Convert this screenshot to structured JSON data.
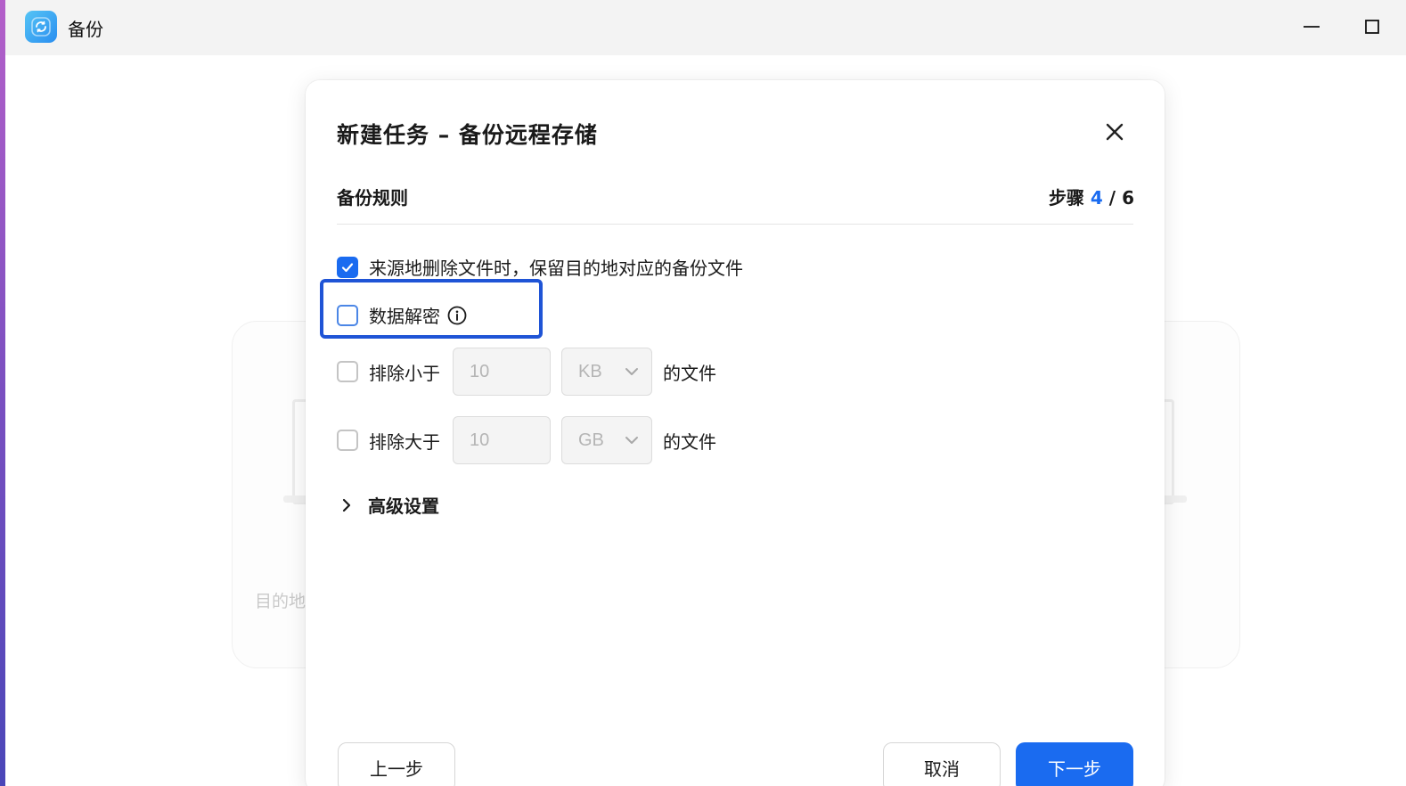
{
  "app": {
    "title": "备份"
  },
  "background": {
    "label": "目的地"
  },
  "dialog": {
    "title": "新建任务 – 备份远程存储",
    "section_title": "备份规则",
    "step_prefix": "步骤",
    "step_current": "4",
    "step_separator": "/",
    "step_total": "6",
    "options": {
      "keep_deleted": {
        "label": "来源地删除文件时，保留目的地对应的备份文件",
        "checked": true
      },
      "decrypt": {
        "label": "数据解密",
        "checked": false
      },
      "exclude_smaller": {
        "label": "排除小于",
        "value": "10",
        "unit": "KB",
        "suffix": "的文件",
        "checked": false
      },
      "exclude_larger": {
        "label": "排除大于",
        "value": "10",
        "unit": "GB",
        "suffix": "的文件",
        "checked": false
      }
    },
    "advanced_label": "高级设置",
    "buttons": {
      "prev": "上一步",
      "cancel": "取消",
      "next": "下一步"
    }
  },
  "colors": {
    "accent": "#1a6bf0",
    "highlight_border": "#1f54d6"
  }
}
